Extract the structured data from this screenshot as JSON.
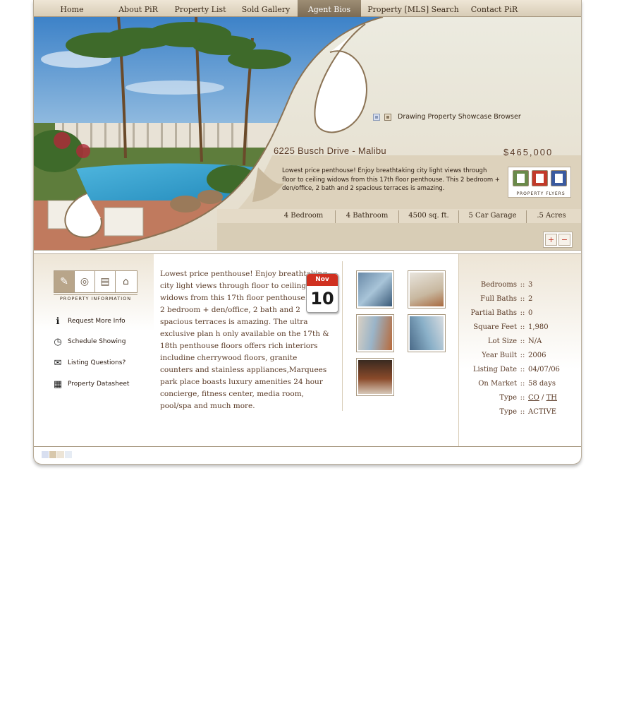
{
  "nav": {
    "items": [
      {
        "label": "Home",
        "active": false
      },
      {
        "label": "About PiR",
        "active": false
      },
      {
        "label": "Property List",
        "active": false
      },
      {
        "label": "Sold Gallery",
        "active": false
      },
      {
        "label": "Agent Bios",
        "active": true
      },
      {
        "label": "Property [MLS] Search",
        "active": false
      },
      {
        "label": "Contact PiR",
        "active": false
      }
    ]
  },
  "hero": {
    "showcase_label": "Drawing Property Showcase Browser",
    "address": "6225 Busch Drive - Malibu",
    "price": "$465,000",
    "description": "Lowest price penthouse! Enjoy breathtaking city light views through floor to ceiling widows from this 17th floor penthouse. This 2 bedroom + den/office, 2 bath and 2 spacious terraces is amazing.",
    "flyers_label": "PROPERTY FLYERS",
    "stats": [
      "4 Bedroom",
      "4 Bathroom",
      "4500 sq. ft.",
      "5 Car Garage",
      ".5 Acres"
    ]
  },
  "sidebar": {
    "tabs_label": "PROPERTY INFORMATION",
    "links": [
      {
        "label": "Request More Info",
        "icon": "info-icon"
      },
      {
        "label": "Schedule Showing",
        "icon": "clock-icon"
      },
      {
        "label": "Listing Questions?",
        "icon": "envelope-icon"
      },
      {
        "label": "Property Datasheet",
        "icon": "datasheet-icon"
      }
    ]
  },
  "listing": {
    "description": "Lowest price penthouse! Enjoy breathtaking city light views through floor to ceiling widows from this 17th floor penthouse. This 2 bedroom + den/office, 2 bath and 2 spacious terraces is amazing. The ultra exclusive plan h only available on the 17th & 18th penthouse floors offers rich interiors includine cherrywood floors, granite counters and stainless appliances,Marquees park place boasts luxury amenities 24 hour concierge, fitness center, media room, pool/spa and much more.",
    "calendar_month": "Nov",
    "calendar_day": "10"
  },
  "specs": [
    {
      "key": "Bedrooms",
      "value": "3"
    },
    {
      "key": "Full Baths",
      "value": "2"
    },
    {
      "key": "Partial Baths",
      "value": "0"
    },
    {
      "key": "Square Feet",
      "value": "1,980"
    },
    {
      "key": "Lot Size",
      "value": "N/A"
    },
    {
      "key": "Year Built",
      "value": "2006"
    },
    {
      "key": "Listing Date",
      "value": "04/07/06"
    },
    {
      "key": "On Market",
      "value": "58 days"
    },
    {
      "key": "Type",
      "value_links": [
        "CO",
        "TH"
      ]
    },
    {
      "key": "Type",
      "value": "ACTIVE"
    }
  ],
  "colors": {
    "accent": "#5a3a26",
    "nav_bg": "#d8ccb6",
    "nav_active": "#8b7b63",
    "calendar_red": "#d03020"
  }
}
